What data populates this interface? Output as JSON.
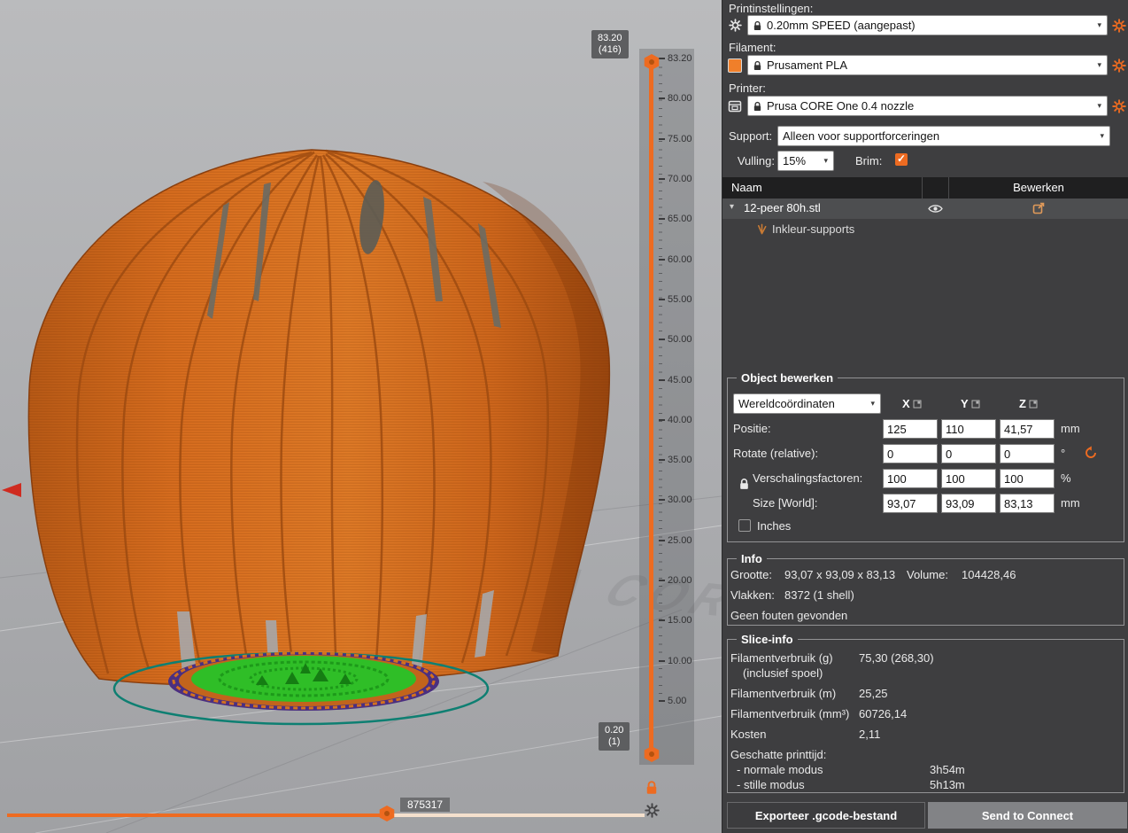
{
  "colors": {
    "accent": "#ED6B21",
    "model_orange": "#D96E1F",
    "base_green": "#2FBE27",
    "base_purple": "#4B2F80",
    "plate_ring_teal": "#0E7F72",
    "filament_swatch": "#F07F2A"
  },
  "viewport": {
    "watermark": "PRUSA CORE",
    "layer_slider": {
      "max_tooltip": [
        "83.20",
        "(416)"
      ],
      "min_tooltip": [
        "0.20",
        "(1)"
      ],
      "ticks": [
        "83.20",
        "80.00",
        "75.00",
        "70.00",
        "65.00",
        "60.00",
        "55.00",
        "50.00",
        "45.00",
        "40.00",
        "35.00",
        "30.00",
        "25.00",
        "20.00",
        "15.00",
        "10.00",
        "5.00"
      ]
    },
    "move_slider": {
      "value": "875317"
    }
  },
  "sidebar": {
    "print_settings": {
      "label": "Printinstellingen:",
      "value": "0.20mm SPEED (aangepast)"
    },
    "filament": {
      "label": "Filament:",
      "value": "Prusament PLA"
    },
    "printer": {
      "label": "Printer:",
      "value": "Prusa CORE One 0.4 nozzle"
    },
    "support": {
      "label": "Support:",
      "value": "Alleen voor supportforceringen"
    },
    "infill": {
      "label": "Vulling:",
      "value": "15%"
    },
    "brim": {
      "label": "Brim:",
      "checked": true
    },
    "object_list": {
      "columns": {
        "name": "Naam",
        "edit": "Bewerken"
      },
      "row": {
        "name": "12-peer 80h.stl"
      },
      "sub_row": {
        "name": "Inkleur-supports"
      }
    },
    "manipulation": {
      "title": "Object bewerken",
      "coord_system": "Wereldcoördinaten",
      "axes": [
        "X",
        "Y",
        "Z"
      ],
      "rows": [
        {
          "label": "Positie:",
          "x": "125",
          "y": "110",
          "z": "41,57",
          "unit": "mm"
        },
        {
          "label": "Rotate (relative):",
          "x": "0",
          "y": "0",
          "z": "0",
          "unit": "°"
        },
        {
          "label": "Verschalingsfactoren:",
          "x": "100",
          "y": "100",
          "z": "100",
          "unit": "%"
        },
        {
          "label": "Size [World]:",
          "x": "93,07",
          "y": "93,09",
          "z": "83,13",
          "unit": "mm"
        }
      ],
      "inches_label": "Inches"
    },
    "info": {
      "title": "Info",
      "size_label": "Grootte:",
      "size_value": "93,07 x 93,09 x 83,13",
      "volume_label": "Volume:",
      "volume_value": "104428,46",
      "facets_label": "Vlakken:",
      "facets_value": "8372 (1 shell)",
      "errors": "Geen fouten gevonden"
    },
    "slice_info": {
      "title": "Slice-info",
      "rows": [
        {
          "label": "Filamentverbruik (g)",
          "value": "75,30 (268,30)"
        },
        {
          "label": "(inclusief spoel)",
          "value": ""
        },
        {
          "label": "Filamentverbruik (m)",
          "value": "25,25"
        },
        {
          "label": "Filamentverbruik (mm³)",
          "value": "60726,14"
        },
        {
          "label": "Kosten",
          "value": "2,11"
        },
        {
          "label": "Geschatte printtijd:",
          "value": ""
        },
        {
          "label": "- normale modus",
          "value": "3h54m"
        },
        {
          "label": "- stille modus",
          "value": "5h13m"
        }
      ]
    },
    "buttons": {
      "export": "Exporteer .gcode-bestand",
      "connect": "Send to Connect"
    }
  }
}
